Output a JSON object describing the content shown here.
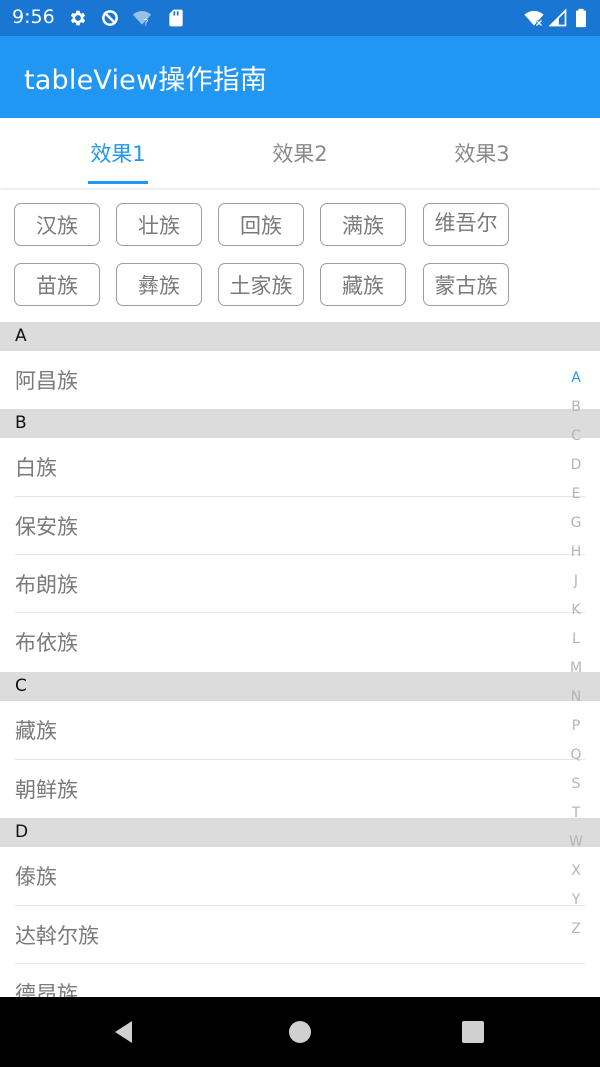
{
  "status_bar": {
    "time": "9:56",
    "icons": [
      "gear-icon",
      "data-saver-icon",
      "wifi-question-icon",
      "sd-card-icon",
      "wifi-off-icon",
      "signal-icon",
      "battery-icon"
    ]
  },
  "app_bar": {
    "title": "tableView操作指南"
  },
  "tabs": [
    {
      "label": "效果1",
      "active": true
    },
    {
      "label": "效果2",
      "active": false
    },
    {
      "label": "效果3",
      "active": false
    }
  ],
  "hot_chips": [
    {
      "label": "汉族"
    },
    {
      "label": "壮族"
    },
    {
      "label": "回族"
    },
    {
      "label": "满族"
    },
    {
      "label": "维吾尔"
    },
    {
      "label": "苗族"
    },
    {
      "label": "彝族"
    },
    {
      "label": "土家族"
    },
    {
      "label": "藏族"
    },
    {
      "label": "蒙古族"
    }
  ],
  "sections": [
    {
      "letter": "A",
      "items": [
        "阿昌族"
      ]
    },
    {
      "letter": "B",
      "items": [
        "白族",
        "保安族",
        "布朗族",
        "布依族"
      ]
    },
    {
      "letter": "C",
      "items": [
        "藏族",
        "朝鲜族"
      ]
    },
    {
      "letter": "D",
      "items": [
        "傣族",
        "达斡尔族",
        "德昂族"
      ]
    }
  ],
  "index_letters": [
    "A",
    "B",
    "C",
    "D",
    "E",
    "G",
    "H",
    "J",
    "K",
    "L",
    "M",
    "N",
    "P",
    "Q",
    "S",
    "T",
    "W",
    "X",
    "Y",
    "Z"
  ],
  "index_active": "A",
  "colors": {
    "primary": "#2196f3",
    "status_bar": "#1976d2",
    "section_header": "#dcdcdc"
  }
}
